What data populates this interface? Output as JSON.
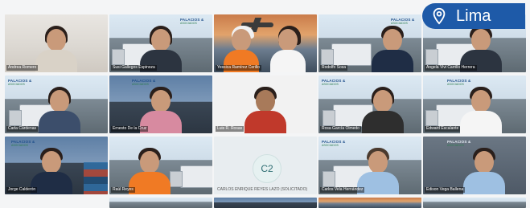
{
  "location_badge": {
    "label": "Lima",
    "icon": "map-pin-icon",
    "color": "#1e5aa8"
  },
  "logo": {
    "line1": "PALACIOS &",
    "line2": "ASOCIADOS",
    "tagline": "AGENTES DE ADUANA"
  },
  "participants": [
    {
      "name": "Andrea Romero"
    },
    {
      "name": "Susi Gallegos Espinoza"
    },
    {
      "name": "Yessica Ramírez Cerillo"
    },
    {
      "name": "Rodolfo Sosa"
    },
    {
      "name": "Angela Vivi Carrillo Herrera"
    },
    {
      "name": "Carla Cárdenas"
    },
    {
      "name": "Ernesto De la Cruz"
    },
    {
      "name": "Luis R. Rosas"
    },
    {
      "name": "Rosa García Olmedo"
    },
    {
      "name": "Edward Escalante"
    },
    {
      "name": "Jorge Calderón"
    },
    {
      "name": "Raúl Reyes"
    },
    {
      "name": "CARLOS ENRIQUE REYES LAZO (SOLICITADO)",
      "initials": "C2"
    },
    {
      "name": "Carlos Vela Hernández"
    },
    {
      "name": "Edison Vega Ballena"
    }
  ]
}
